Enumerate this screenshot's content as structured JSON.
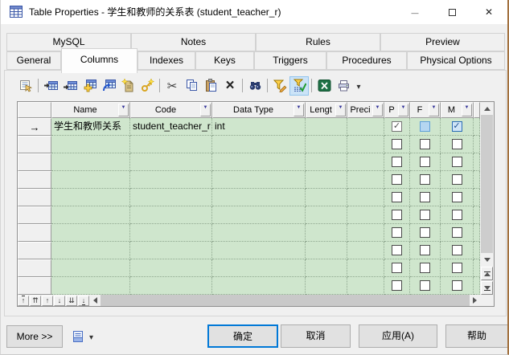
{
  "window": {
    "title": "Table Properties - 学生和教师的关系表 (student_teacher_r)"
  },
  "tabs_top": [
    "MySQL",
    "Notes",
    "Rules",
    "Preview"
  ],
  "tabs_bottom": [
    "General",
    "Columns",
    "Indexes",
    "Keys",
    "Triggers",
    "Procedures",
    "Physical Options"
  ],
  "selected_tab": "Columns",
  "toolbar_icons": [
    "properties",
    "insert-row",
    "add-row",
    "add-columns",
    "replicate-columns",
    "new-attribute",
    "create-key",
    "cut",
    "copy",
    "paste",
    "delete",
    "find",
    "filter-edit",
    "filter-toggle-on",
    "export-excel",
    "print",
    "more-tools-dropdown"
  ],
  "grid": {
    "headers": [
      "Name",
      "Code",
      "Data Type",
      "Lengt",
      "Preci",
      "P",
      "F",
      "M"
    ],
    "row": {
      "name": "学生和教师关系",
      "code": "student_teacher_r",
      "data_type": "int",
      "length": "",
      "precision": ""
    },
    "checkbox_states": {
      "p": "checked",
      "f": "highlighted-unchecked",
      "m": "checked-blue"
    },
    "empty_row_count": 9
  },
  "footer": {
    "more_label": "More >>",
    "ok_label": "确定",
    "cancel_label": "取消",
    "apply_label": "应用(A)",
    "help_label": "帮助"
  },
  "colors": {
    "grid_green": "#cfe6cd",
    "accent_blue": "#0078d7",
    "checkbox_blue_fill": "#b5d6f1",
    "checkbox_blue_border": "#2b6cb5",
    "filter_active_bg": "#cbe3f7"
  }
}
